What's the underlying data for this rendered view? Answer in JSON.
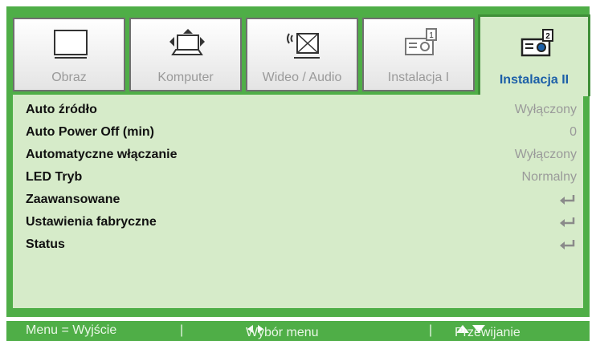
{
  "tabs": [
    {
      "label": "Obraz",
      "icon": "monitor-icon"
    },
    {
      "label": "Komputer",
      "icon": "computer-icon"
    },
    {
      "label": "Wideo / Audio",
      "icon": "video-audio-icon"
    },
    {
      "label": "Instalacja I",
      "icon": "projector-1-icon"
    },
    {
      "label": "Instalacja II",
      "icon": "projector-2-icon",
      "active": true
    }
  ],
  "rows": [
    {
      "label": "Auto źródło",
      "value": "Wyłączony"
    },
    {
      "label": "Auto Power Off (min)",
      "value": "0"
    },
    {
      "label": "Automatyczne włączanie",
      "value": "Wyłączony"
    },
    {
      "label": "LED Tryb",
      "value": "Normalny"
    },
    {
      "label": "Zaawansowane",
      "icon": "enter-icon"
    },
    {
      "label": "Ustawienia fabryczne",
      "icon": "enter-icon"
    },
    {
      "label": "Status",
      "icon": "enter-icon"
    }
  ],
  "footer": {
    "menu": "Menu = Wyjście",
    "sep1": "|",
    "select": "Wybór menu",
    "sep2": "|",
    "scroll": "Przewijanie"
  },
  "colors": {
    "frame": "#4fae47",
    "panel": "#d6ebc9",
    "active_label": "#1c5fa8",
    "value": "#9a9a9a"
  }
}
